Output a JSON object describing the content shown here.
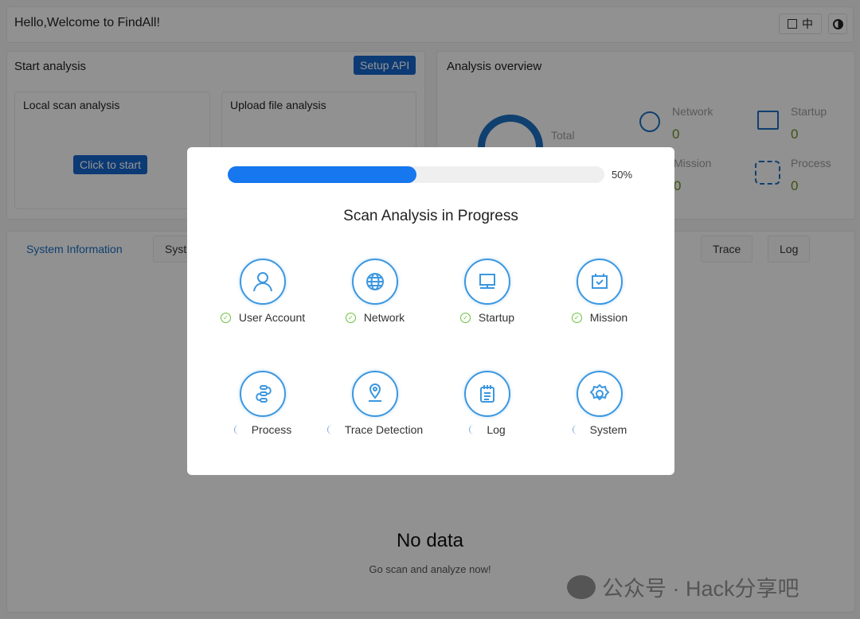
{
  "header": {
    "title": "Hello,Welcome to FindAll!",
    "lang_label": "中",
    "icons": [
      "translate-icon",
      "theme-toggle-icon"
    ]
  },
  "start": {
    "title": "Start analysis",
    "setup_api": "Setup API",
    "local": {
      "title": "Local scan analysis",
      "button": "Click to start"
    },
    "upload": {
      "title": "Upload file analysis"
    }
  },
  "overview": {
    "title": "Analysis overview",
    "total_label": "Total",
    "stats": [
      {
        "label": "Network",
        "value": "0"
      },
      {
        "label": "Startup",
        "value": "0"
      },
      {
        "label": "Mission",
        "value": "0"
      },
      {
        "label": "Process",
        "value": "0"
      }
    ]
  },
  "tabs": [
    {
      "label": "System Information",
      "active": true
    },
    {
      "label": "Syst"
    },
    {
      "label": "Trace"
    },
    {
      "label": "Log"
    }
  ],
  "empty": {
    "title": "No data",
    "subtitle": "Go scan and analyze now!"
  },
  "modal": {
    "progress": 50,
    "progress_label": "50%",
    "title": "Scan Analysis in Progress",
    "items": [
      {
        "label": "User Account",
        "icon": "user-icon",
        "done": true
      },
      {
        "label": "Network",
        "icon": "globe-icon",
        "done": true
      },
      {
        "label": "Startup",
        "icon": "monitor-icon",
        "done": true
      },
      {
        "label": "Mission",
        "icon": "calendar-check-icon",
        "done": true
      },
      {
        "label": "Process",
        "icon": "process-flow-icon",
        "done": false
      },
      {
        "label": "Trace Detection",
        "icon": "location-pin-icon",
        "done": false
      },
      {
        "label": "Log",
        "icon": "log-list-icon",
        "done": false
      },
      {
        "label": "System",
        "icon": "gear-icon",
        "done": false
      }
    ]
  },
  "watermark": "公众号 · Hack分享吧",
  "colors": {
    "accent": "#1677ee",
    "button": "#1565c8",
    "success": "#67c23a",
    "icon": "#3b97e0"
  }
}
